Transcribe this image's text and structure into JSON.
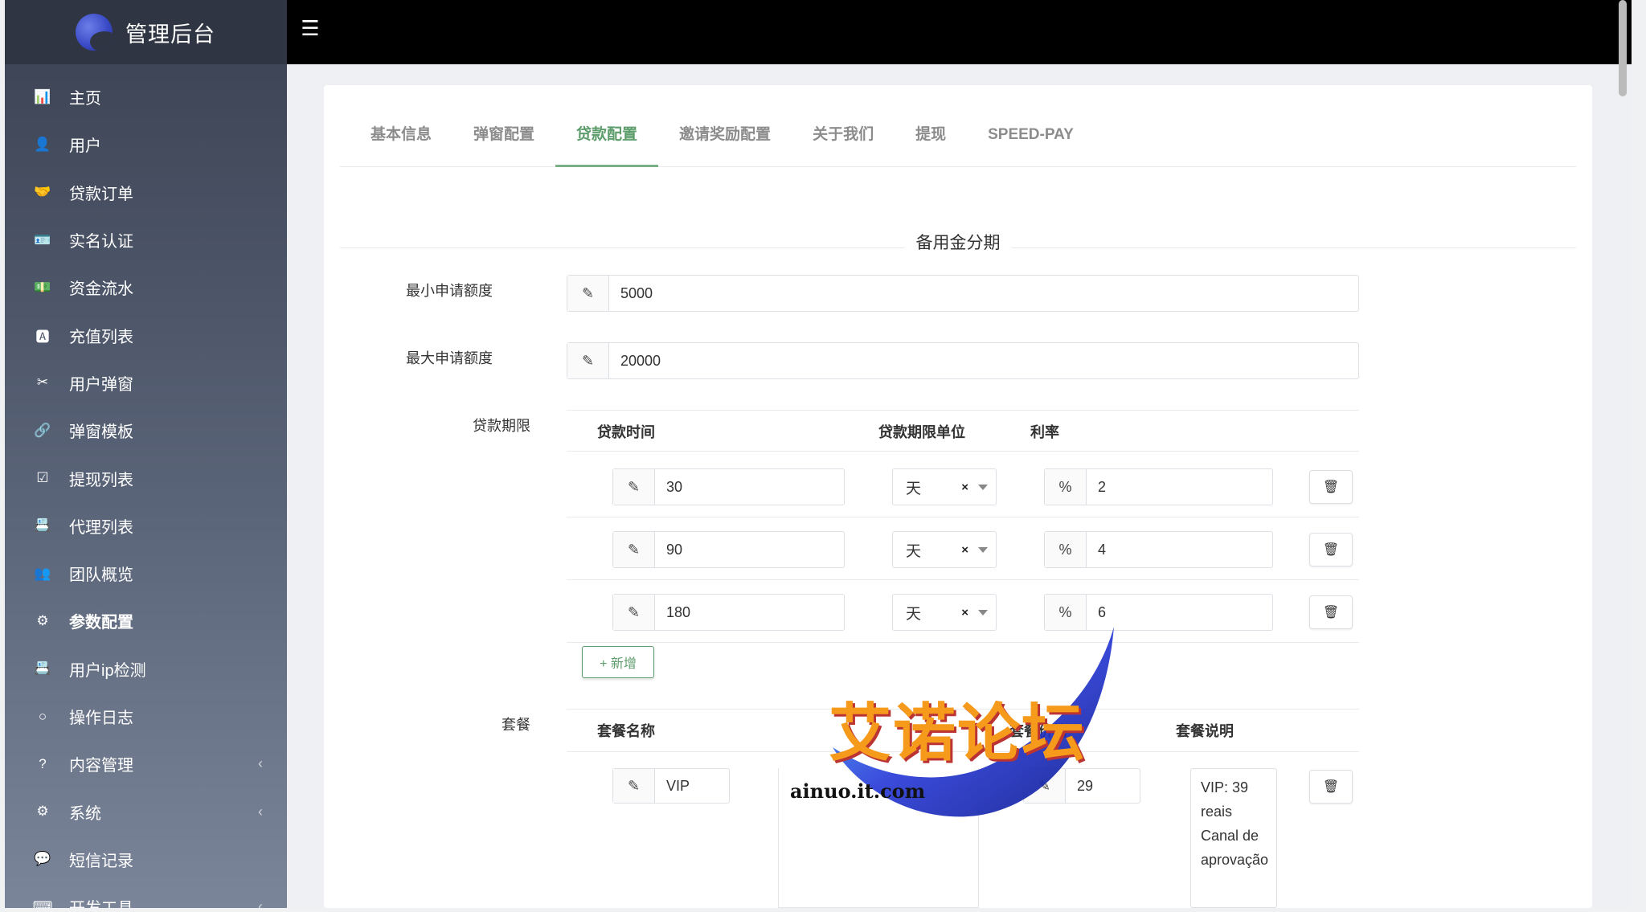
{
  "brand": {
    "title": "管理后台"
  },
  "sidebar": {
    "items": [
      {
        "label": "主页",
        "icon": "bar-chart-icon",
        "glyph": "📊"
      },
      {
        "label": "用户",
        "icon": "user-icon",
        "glyph": "👤"
      },
      {
        "label": "贷款订单",
        "icon": "loan-icon",
        "glyph": "🤝"
      },
      {
        "label": "实名认证",
        "icon": "id-card-icon",
        "glyph": "🪪"
      },
      {
        "label": "资金流水",
        "icon": "money-icon",
        "glyph": "💵"
      },
      {
        "label": "充值列表",
        "icon": "recharge-icon",
        "glyph": "🅰"
      },
      {
        "label": "用户弹窗",
        "icon": "popup-icon",
        "glyph": "✂"
      },
      {
        "label": "弹窗模板",
        "icon": "template-icon",
        "glyph": "🔗"
      },
      {
        "label": "提现列表",
        "icon": "check-icon",
        "glyph": "☑"
      },
      {
        "label": "代理列表",
        "icon": "agent-icon",
        "glyph": "📇"
      },
      {
        "label": "团队概览",
        "icon": "team-icon",
        "glyph": "👥"
      },
      {
        "label": "参数配置",
        "icon": "gears-icon",
        "glyph": "⚙"
      },
      {
        "label": "用户ip检测",
        "icon": "ip-icon",
        "glyph": "📇"
      },
      {
        "label": "操作日志",
        "icon": "circle-icon",
        "glyph": "○"
      },
      {
        "label": "内容管理",
        "icon": "question-icon",
        "glyph": "?"
      },
      {
        "label": "系统",
        "icon": "gear-icon",
        "glyph": "⚙"
      },
      {
        "label": "短信记录",
        "icon": "chat-icon",
        "glyph": "💬"
      },
      {
        "label": "开发工具",
        "icon": "keyboard-icon",
        "glyph": "⌨"
      }
    ],
    "chevron": "‹"
  },
  "tabs": [
    "基本信息",
    "弹窗配置",
    "贷款配置",
    "邀请奖励配置",
    "关于我们",
    "提现",
    "SPEED-PAY"
  ],
  "section": {
    "title": "备用金分期"
  },
  "form": {
    "min_label": "最小申请额度",
    "min_value": "5000",
    "max_label": "最大申请额度",
    "max_value": "20000",
    "term_label": "贷款期限",
    "term_headers": [
      "贷款时间",
      "贷款期限单位",
      "利率"
    ],
    "terms": [
      {
        "time": "30",
        "unit": "天",
        "rate": "2"
      },
      {
        "time": "90",
        "unit": "天",
        "rate": "4"
      },
      {
        "time": "180",
        "unit": "天",
        "rate": "6"
      }
    ],
    "percent": "%",
    "add_label": "+ 新增",
    "package_label": "套餐",
    "package_headers": [
      "套餐名称",
      "套餐价格",
      "套餐说明"
    ],
    "package": {
      "name": "VIP",
      "price": "29",
      "desc": "VIP: 39 reais Canal de aprovação"
    }
  },
  "watermark": {
    "text": "艾诺论坛",
    "url": "ainuo.it.com"
  }
}
